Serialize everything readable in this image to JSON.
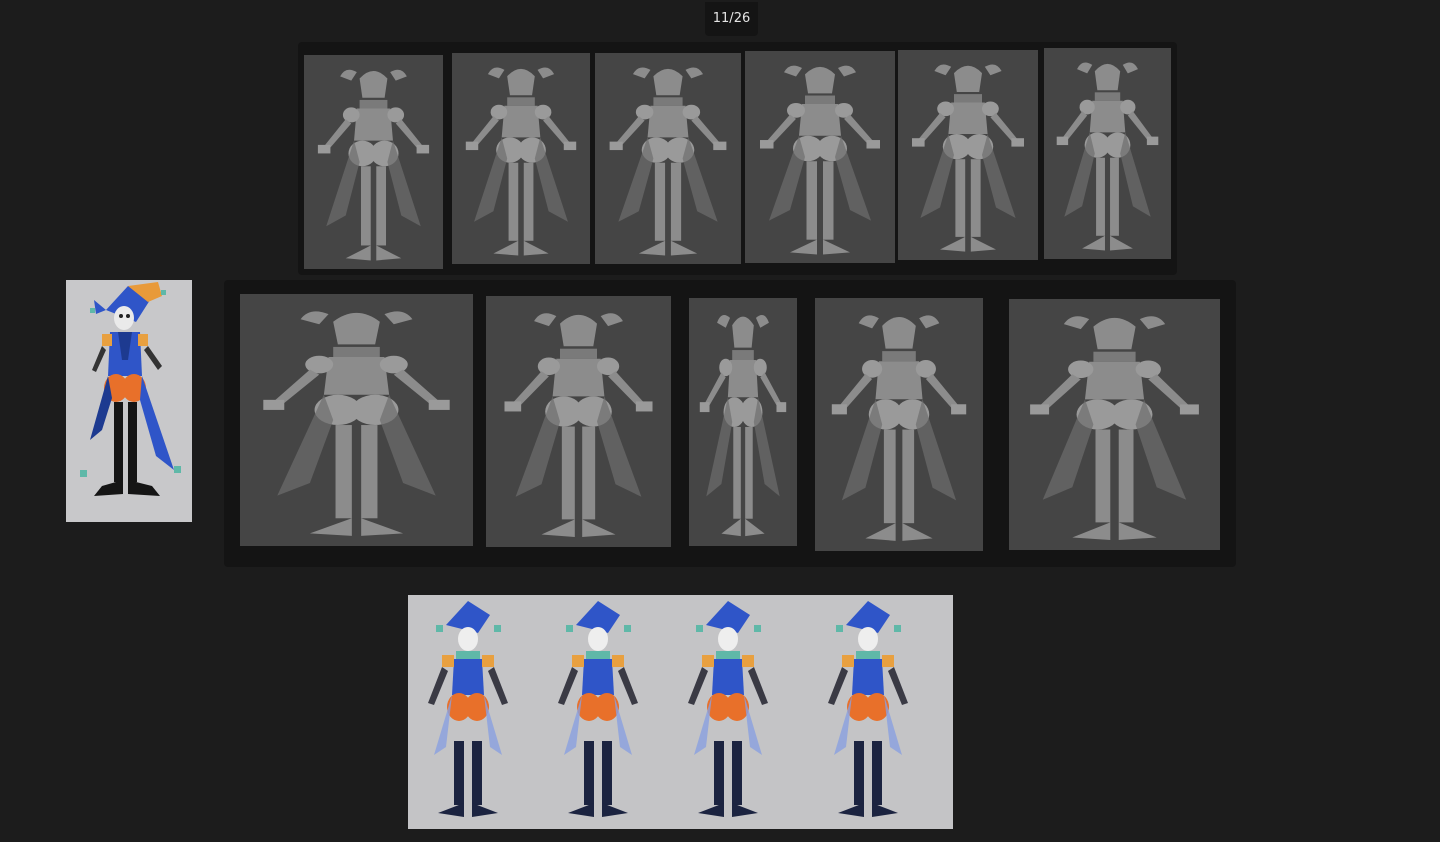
{
  "viewer": {
    "counter": "11/26"
  },
  "colors": {
    "background": "#1c1c1c",
    "panel": "#141414",
    "render_bg": "#454545",
    "sculpt": "#8c8c8c",
    "jester_blue": "#2f55c8",
    "jester_orange": "#e8702a",
    "jester_teal": "#5fb8a8"
  },
  "gallery": {
    "top_row_views": [
      "front",
      "three-quarter-front",
      "side",
      "back",
      "three-quarter-back",
      "three-quarter-side"
    ],
    "middle_row_views": [
      "front",
      "three-quarter-front",
      "side",
      "three-quarter-back",
      "back"
    ],
    "sheet_views": [
      "front",
      "three-quarter",
      "side",
      "back"
    ]
  }
}
